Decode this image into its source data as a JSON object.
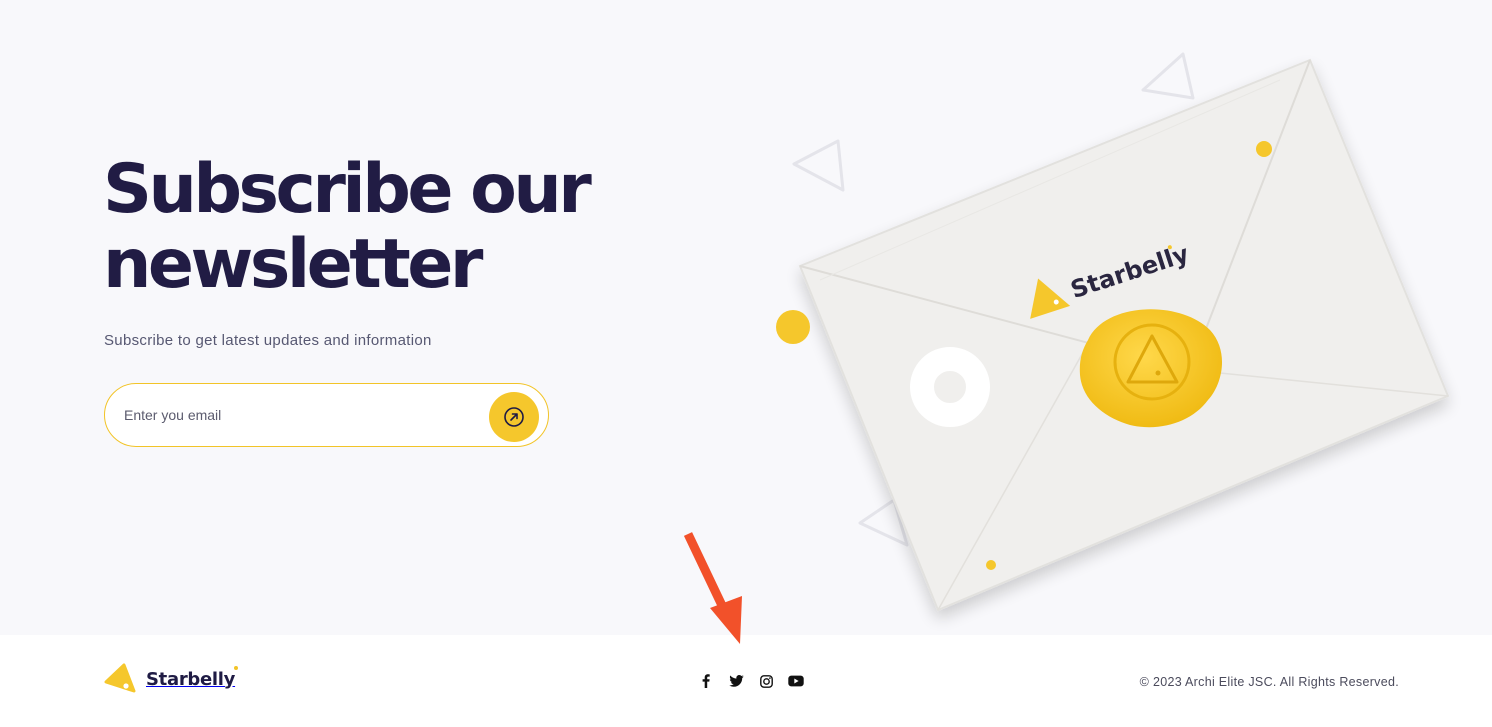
{
  "hero": {
    "headline": "Subscribe our newsletter",
    "subtitle": "Subscribe to get latest updates and information"
  },
  "form": {
    "email_value": "",
    "email_placeholder": "Enter you email",
    "submit_icon": "arrow-up-right-circle-icon"
  },
  "envelope": {
    "brand_text": "Starbelly"
  },
  "footer": {
    "brand_name": "Starbelly",
    "social_icons": [
      "facebook-icon",
      "twitter-icon",
      "instagram-icon",
      "youtube-icon"
    ],
    "copyright": "© 2023 Archi Elite JSC. All Rights Reserved."
  },
  "colors": {
    "accent": "#f5c72c",
    "heading": "#211c44",
    "background": "#f8f8fb",
    "annotation": "#f2512a"
  }
}
